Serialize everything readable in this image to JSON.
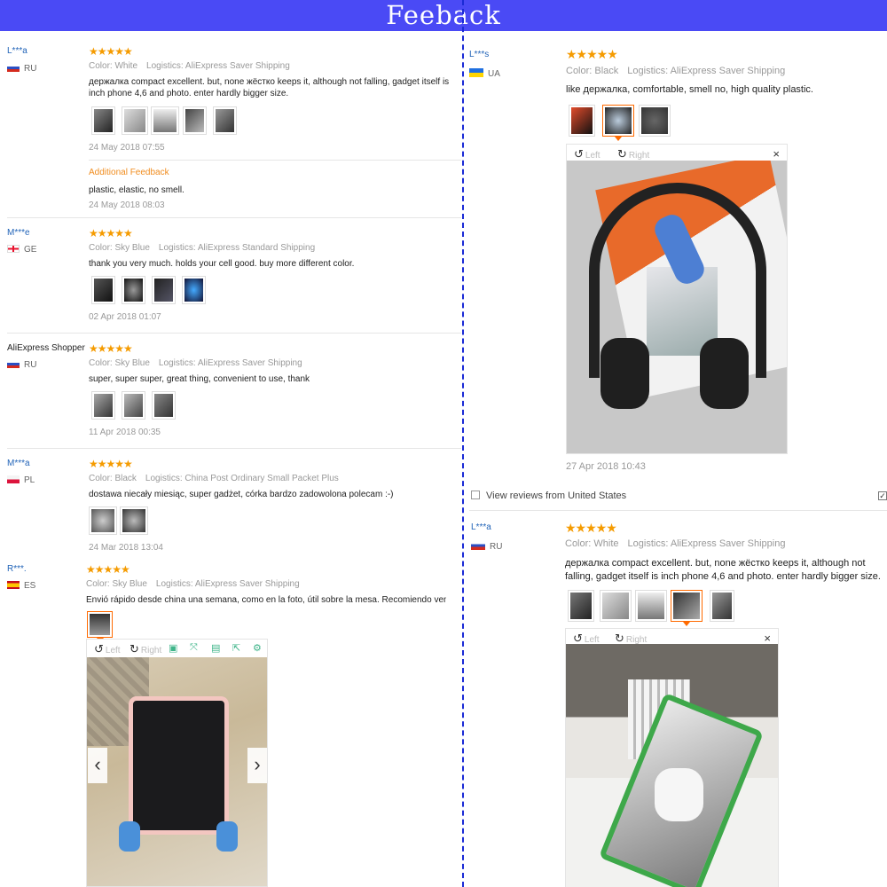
{
  "banner": {
    "title": "Feeback"
  },
  "viewer_labels": {
    "left": "Left",
    "right": "Right",
    "close": "×"
  },
  "left_column": {
    "reviews": [
      {
        "user": "L***a",
        "country": "RU",
        "stars": "★★★★★",
        "color": "Color: White",
        "logistics": "Logistics: AliExpress Saver Shipping",
        "text": "держалка compact excellent. but, none жёстко keeps it, although not falling, gadget itself is inch phone 4,6 and photo. enter hardly bigger size.",
        "date": "24 May 2018 07:55",
        "additional_label": "Additional Feedback",
        "additional_text": "plastic, elastic, no smell.",
        "additional_date": "24 May 2018 08:03"
      },
      {
        "user": "M***e",
        "country": "GE",
        "stars": "★★★★★",
        "color": "Color: Sky Blue",
        "logistics": "Logistics: AliExpress Standard Shipping",
        "text": "thank you very much. holds your cell good. buy more different color.",
        "date": "02 Apr 2018 01:07"
      },
      {
        "user": "AliExpress Shopper",
        "country": "RU",
        "stars": "★★★★★",
        "color": "Color: Sky Blue",
        "logistics": "Logistics: AliExpress Saver Shipping",
        "text": "super, super super, great thing, convenient to use, thank",
        "date": "11 Apr 2018 00:35"
      },
      {
        "user": "M***a",
        "country": "PL",
        "stars": "★★★★★",
        "color": "Color: Black",
        "logistics": "Logistics: China Post Ordinary Small Packet Plus",
        "text": "dostawa niecały miesiąc, super gadżet, córka bardzo zadowolona polecam :-)",
        "date": "24 Mar 2018 13:04"
      },
      {
        "user": "R***.",
        "country": "ES",
        "stars": "★★★★★",
        "color": "Color: Sky Blue",
        "logistics": "Logistics: AliExpress Saver Shipping",
        "text": "Envió rápido desde china una semana, como en la foto, útil sobre la mesa. Recomiendo vendedor"
      }
    ],
    "viewer_nav": {
      "prev": "‹",
      "next": "›"
    }
  },
  "right_column": {
    "reviews": [
      {
        "user": "L***s",
        "country": "UA",
        "stars": "★★★★★",
        "color": "Color: Black",
        "logistics": "Logistics: AliExpress Saver Shipping",
        "text": "like держалка, comfortable, smell no, high quality plastic.",
        "date": "27 Apr 2018 10:43"
      },
      {
        "user": "L***a",
        "country": "RU",
        "stars": "★★★★★",
        "color": "Color: White",
        "logistics": "Logistics: AliExpress Saver Shipping",
        "text": "держалка compact excellent. but, none жёстко keeps it, although not falling, gadget itself is inch phone 4,6 and photo. enter hardly bigger size."
      }
    ],
    "filter": {
      "label": "View reviews from United States"
    }
  },
  "colors": {
    "banner": "#4a4af5",
    "divider": "#1a2ad6",
    "stars": "#f59b00",
    "username": "#2264b8",
    "additional": "#f08c1e",
    "selected_thumb": "#ff6a00"
  }
}
